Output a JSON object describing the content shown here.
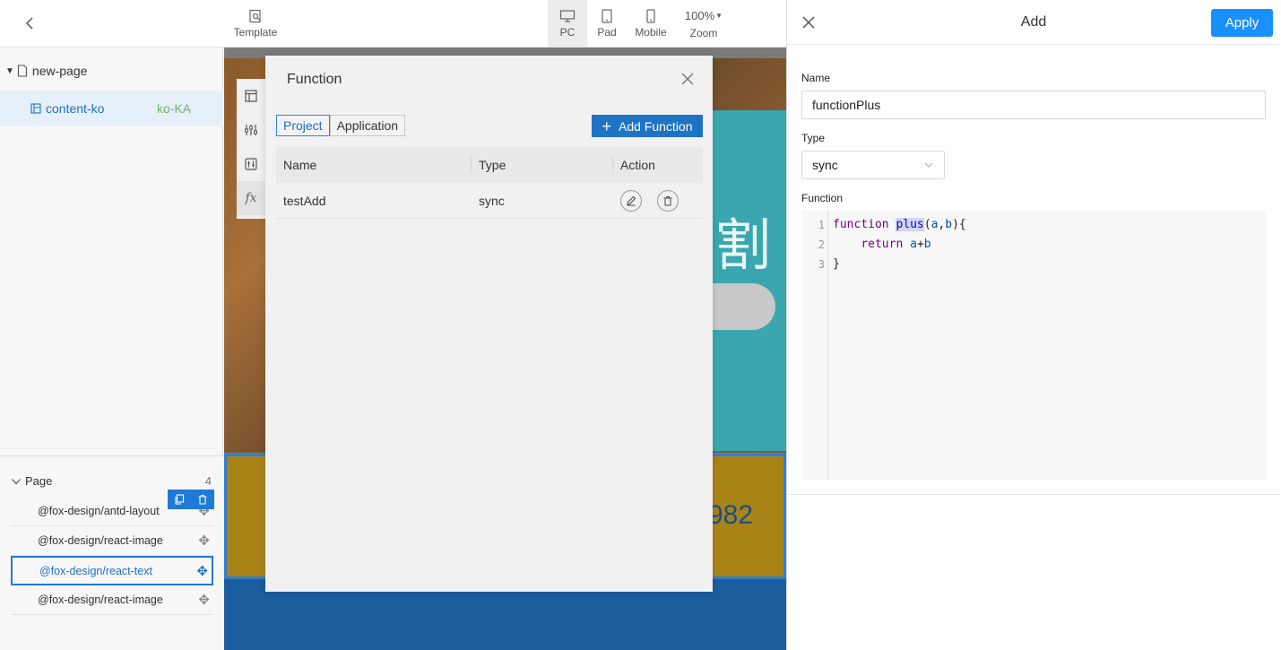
{
  "toolbar": {
    "template_label": "Template",
    "devices": [
      {
        "label": "PC",
        "active": true
      },
      {
        "label": "Pad",
        "active": false
      },
      {
        "label": "Mobile",
        "active": false
      }
    ],
    "zoom_value": "100%",
    "zoom_label": "Zoom"
  },
  "page_tree": {
    "root": "new-page",
    "child": {
      "name": "content-ko",
      "locale": "ko-KA"
    }
  },
  "outline": {
    "title": "Page",
    "count": "4",
    "items": [
      {
        "label": "@fox-design/antd-layout",
        "selected": false
      },
      {
        "label": "@fox-design/react-image",
        "selected": false
      },
      {
        "label": "@fox-design/react-text",
        "selected": true
      },
      {
        "label": "@fox-design/react-image",
        "selected": false
      }
    ]
  },
  "canvas": {
    "kanji": "割",
    "number": "982"
  },
  "function_modal": {
    "title": "Function",
    "tabs": [
      {
        "label": "Project",
        "active": true
      },
      {
        "label": "Application",
        "active": false
      }
    ],
    "add_button": "Add Function",
    "columns": [
      "Name",
      "Type",
      "Action"
    ],
    "rows": [
      {
        "name": "testAdd",
        "type": "sync"
      }
    ]
  },
  "add_panel": {
    "title": "Add",
    "apply_label": "Apply",
    "name_label": "Name",
    "name_value": "functionPlus",
    "type_label": "Type",
    "type_value": "sync",
    "function_label": "Function",
    "code": {
      "line_numbers": [
        "1",
        "2",
        "3"
      ],
      "l1_kw": "function",
      "l1_name": "plus",
      "l1_open": "(",
      "l1_a": "a",
      "l1_comma": ",",
      "l1_b": "b",
      "l1_close": "){",
      "l2_indent": "    ",
      "l2_kw": "return",
      "l2_a": "a",
      "l2_op": "+",
      "l2_b": "b",
      "l3": "}"
    }
  },
  "colors": {
    "primary": "#1890ff",
    "selected_blue": "#1f7ad6",
    "locale_green": "#73b36b"
  }
}
